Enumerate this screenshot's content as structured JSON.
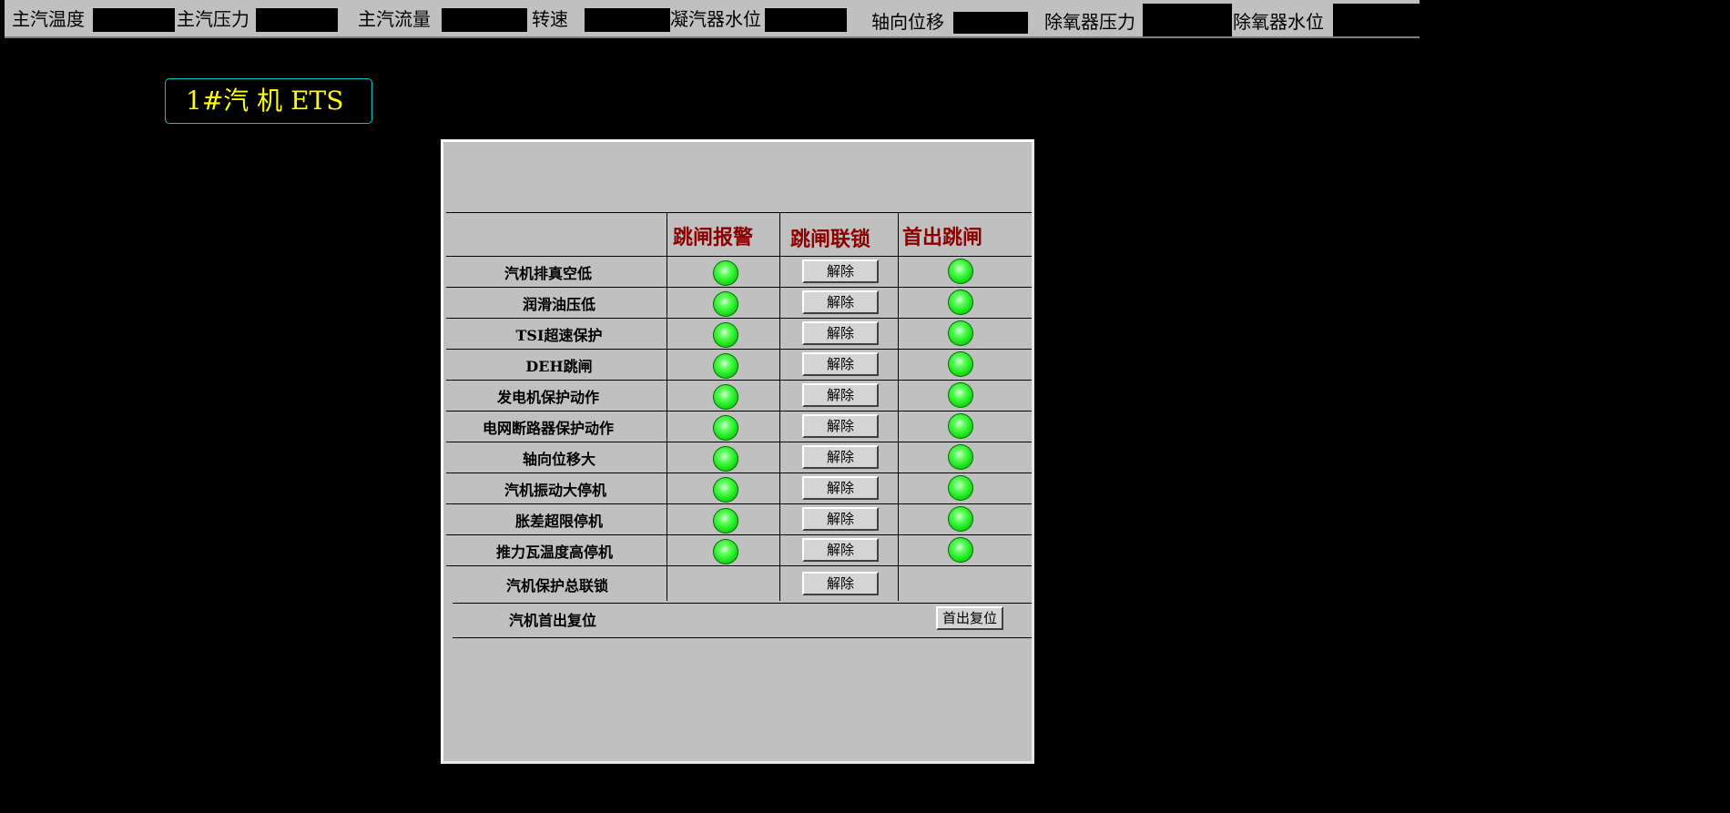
{
  "topbar": {
    "items": [
      {
        "label": "主汽温度",
        "value": ""
      },
      {
        "label": "主汽压力",
        "value": ""
      },
      {
        "label": "主汽流量",
        "value": ""
      },
      {
        "label": "转速",
        "value": ""
      },
      {
        "label": "凝汽器水位",
        "value": ""
      },
      {
        "label": "轴向位移",
        "value": ""
      },
      {
        "label": "除氧器压力",
        "value": ""
      },
      {
        "label": "除氧器水位",
        "value": ""
      }
    ]
  },
  "title": "1#汽 机 ETS",
  "panel": {
    "headers": {
      "alarm": "跳闸报警",
      "interlock": "跳闸联锁",
      "first_out": "首出跳闸"
    },
    "rows": [
      {
        "label": "汽机排真空低",
        "button": "解除",
        "alarm": "green",
        "first_out": "green"
      },
      {
        "label": "润滑油压低",
        "button": "解除",
        "alarm": "green",
        "first_out": "green"
      },
      {
        "label": "TSI超速保护",
        "button": "解除",
        "alarm": "green",
        "first_out": "green"
      },
      {
        "label": "DEH跳闸",
        "button": "解除",
        "alarm": "green",
        "first_out": "green"
      },
      {
        "label": "发电机保护动作",
        "button": "解除",
        "alarm": "green",
        "first_out": "green"
      },
      {
        "label": "电网断路器保护动作",
        "button": "解除",
        "alarm": "green",
        "first_out": "green"
      },
      {
        "label": "轴向位移大",
        "button": "解除",
        "alarm": "green",
        "first_out": "green"
      },
      {
        "label": "汽机振动大停机",
        "button": "解除",
        "alarm": "green",
        "first_out": "green"
      },
      {
        "label": "胀差超限停机",
        "button": "解除",
        "alarm": "green",
        "first_out": "green"
      },
      {
        "label": "推力瓦温度高停机",
        "button": "解除",
        "alarm": "green",
        "first_out": "green"
      }
    ],
    "master_interlock": {
      "label": "汽机保护总联锁",
      "button": "解除"
    },
    "first_out_reset": {
      "label": "汽机首出复位",
      "button": "首出复位"
    }
  },
  "colors": {
    "led_on": "#18e018",
    "header_text": "#8b0000",
    "title_text": "#ffff00",
    "title_border": "#00c8c8"
  }
}
